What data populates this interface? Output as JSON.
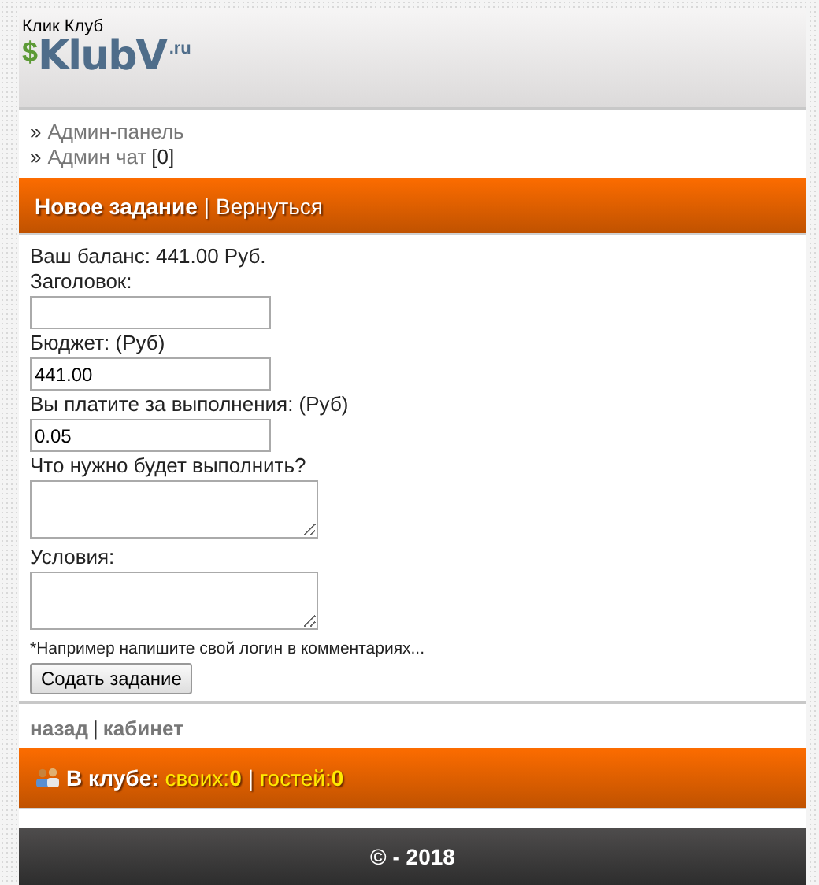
{
  "header": {
    "site_name": "Клик Клуб",
    "logo": {
      "symbol": "$",
      "name": "KlubV",
      "suffix": ".ru"
    }
  },
  "admin_links": [
    {
      "bullet": "»",
      "label": "Админ-панель"
    },
    {
      "bullet": "»",
      "label": "Админ чат",
      "count": "[0]"
    }
  ],
  "title_bar": {
    "title": "Новое задание",
    "separator": "|",
    "link": "Вернуться"
  },
  "form": {
    "balance": "Ваш баланс: 441.00 Руб.",
    "fields": [
      {
        "kind": "input",
        "label": "Заголовок:"
      },
      {
        "kind": "input",
        "label": "Бюджет: (Руб)",
        "value": "441.00"
      },
      {
        "kind": "input",
        "label": "Вы платите за выполнения: (Руб)",
        "value": "0.05"
      },
      {
        "kind": "textarea",
        "label": "Что нужно будет выполнить?"
      },
      {
        "kind": "textarea",
        "label": "Условия:"
      }
    ],
    "note": "*Например напишите свой логин в комментариях...",
    "submit": "Содать задание"
  },
  "nav_links": [
    {
      "label": "назад"
    },
    {
      "separator": "|",
      "label": "кабинет"
    }
  ],
  "club_bar": {
    "label": "В клубе:",
    "members_label": "своих:",
    "members": "0",
    "separator": "|",
    "guests_label": "гостей:",
    "guests": "0"
  },
  "footer": "© - 2018"
}
